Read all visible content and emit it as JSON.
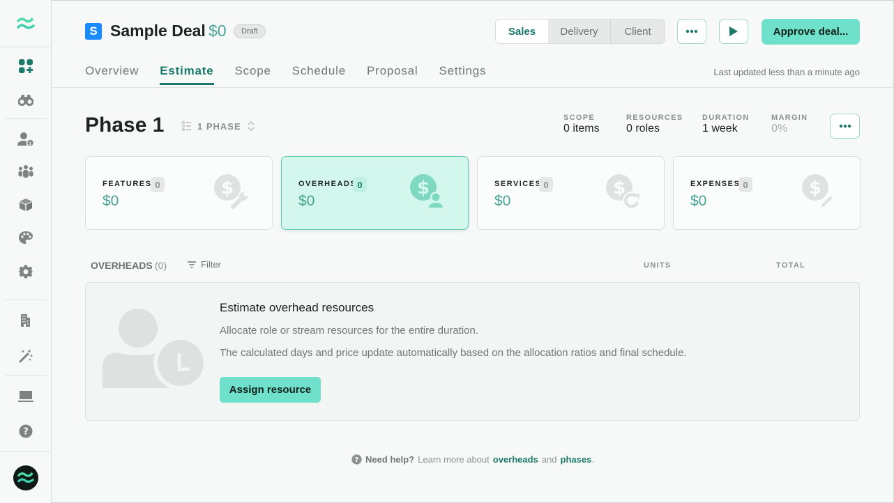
{
  "sidebar": {
    "items": [
      {
        "name": "dashboard",
        "icon": "apps-add-icon",
        "active": true
      },
      {
        "name": "explore",
        "icon": "binoculars-icon"
      },
      {
        "name": "clients",
        "icon": "user-dollar-icon"
      },
      {
        "name": "teams",
        "icon": "team-icon"
      },
      {
        "name": "products",
        "icon": "cube-icon"
      },
      {
        "name": "styles",
        "icon": "palette-icon"
      },
      {
        "name": "settings",
        "icon": "gear-icon"
      },
      {
        "name": "company",
        "icon": "building-icon"
      },
      {
        "name": "magic",
        "icon": "magic-wand-icon"
      },
      {
        "name": "workspace",
        "icon": "laptop-icon"
      },
      {
        "name": "help",
        "icon": "help-icon"
      }
    ]
  },
  "header": {
    "badge_letter": "S",
    "title": "Sample Deal",
    "price": "$0",
    "status": "Draft",
    "views": [
      "Sales",
      "Delivery",
      "Client"
    ],
    "active_view": "Sales",
    "approve_label": "Approve deal...",
    "last_updated": "Last updated less than a minute ago"
  },
  "tabs": [
    {
      "label": "Overview"
    },
    {
      "label": "Estimate",
      "active": true
    },
    {
      "label": "Scope"
    },
    {
      "label": "Schedule"
    },
    {
      "label": "Proposal"
    },
    {
      "label": "Settings"
    }
  ],
  "phase": {
    "title": "Phase 1",
    "selector_label": "1 PHASE",
    "stats": [
      {
        "label": "SCOPE",
        "value": "0 items"
      },
      {
        "label": "RESOURCES",
        "value": "0 roles"
      },
      {
        "label": "DURATION",
        "value": "1 week"
      },
      {
        "label": "MARGIN",
        "value": "0%"
      }
    ]
  },
  "cards": [
    {
      "title": "FEATURES",
      "count": "0",
      "value": "$0",
      "icon": "dollar-wrench-icon"
    },
    {
      "title": "OVERHEADS",
      "count": "0",
      "value": "$0",
      "icon": "dollar-user-icon",
      "active": true
    },
    {
      "title": "SERVICES",
      "count": "0",
      "value": "$0",
      "icon": "dollar-refresh-icon"
    },
    {
      "title": "EXPENSES",
      "count": "0",
      "value": "$0",
      "icon": "dollar-pencil-icon"
    }
  ],
  "list": {
    "title": "OVERHEADS",
    "count": "(0)",
    "filter_label": "Filter",
    "columns": [
      "UNITS",
      "TOTAL"
    ]
  },
  "empty_state": {
    "heading": "Estimate overhead resources",
    "line1": "Allocate role or stream resources for the entire duration.",
    "line2": "The calculated days and price update automatically based on the allocation ratios and final schedule.",
    "button": "Assign resource"
  },
  "help": {
    "prefix": "Need help?",
    "text": "Learn more about",
    "link1": "overheads",
    "and": "and",
    "link2": "phases",
    "suffix": "."
  },
  "colors": {
    "accent": "#1d7a69",
    "primary_button": "#6fe0c9",
    "price": "#4aa394",
    "badge_blue": "#1a8cff"
  }
}
